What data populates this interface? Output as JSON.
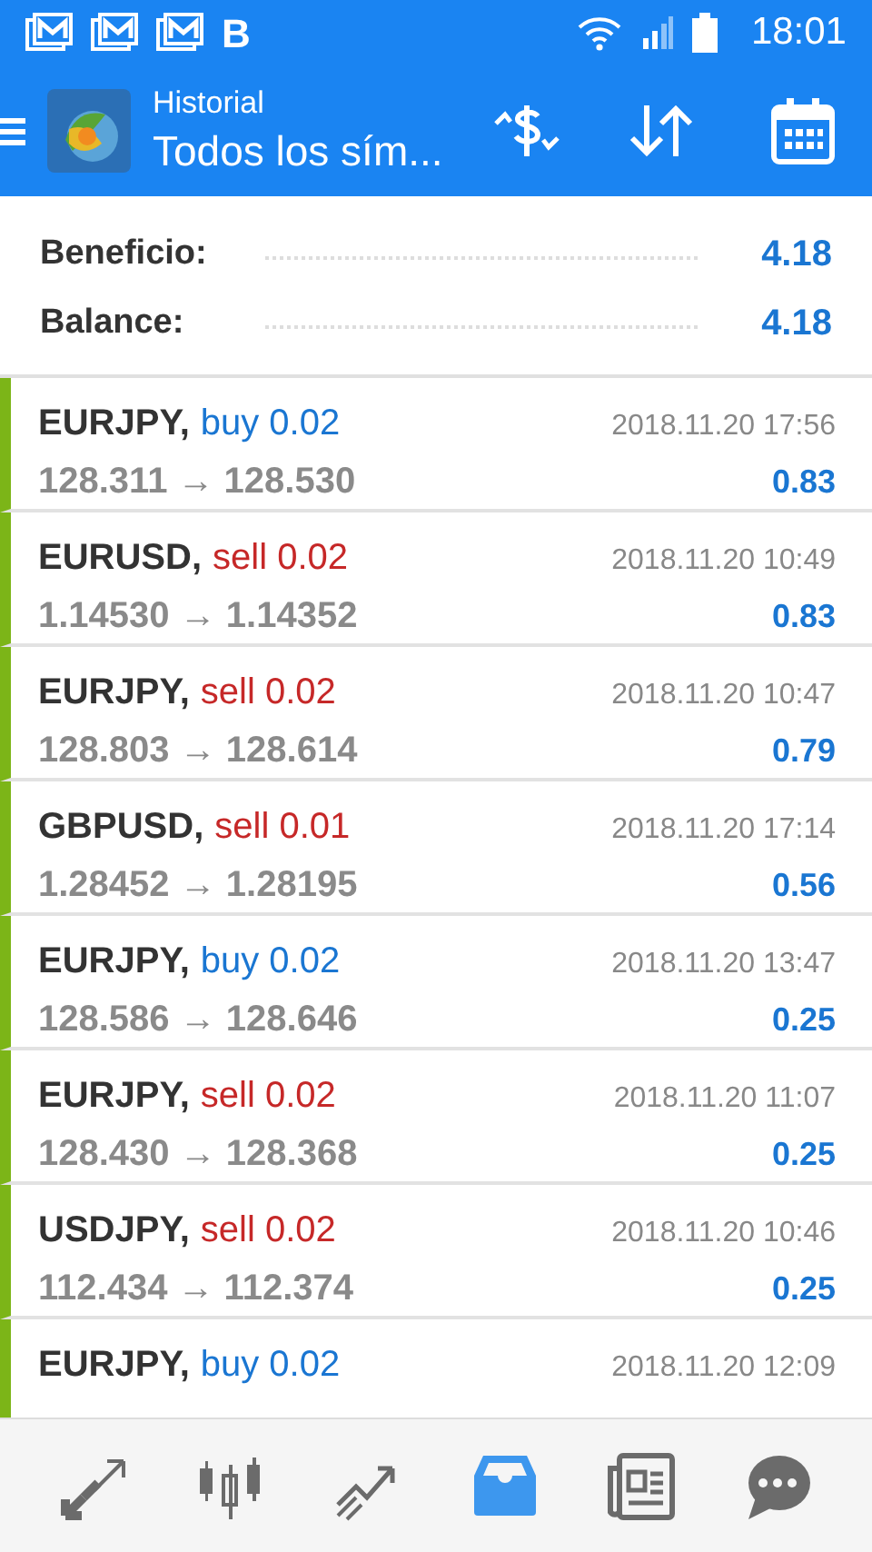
{
  "status_bar": {
    "time": "18:01",
    "notification_letter": "B"
  },
  "toolbar": {
    "subtitle": "Historial",
    "title": "Todos los sím..."
  },
  "summary": [
    {
      "label": "Beneficio:",
      "value": "4.18"
    },
    {
      "label": "Balance:",
      "value": "4.18"
    }
  ],
  "deals": [
    {
      "symbol": "EURJPY,",
      "side": "buy",
      "kind": "buy",
      "volume": "0.02",
      "time": "2018.11.20 17:56",
      "prices": "128.311 → 128.530",
      "profit": "0.83"
    },
    {
      "symbol": "EURUSD,",
      "side": "sell",
      "kind": "sell",
      "volume": "0.02",
      "time": "2018.11.20 10:49",
      "prices": "1.14530 → 1.14352",
      "profit": "0.83"
    },
    {
      "symbol": "EURJPY,",
      "side": "sell",
      "kind": "sell",
      "volume": "0.02",
      "time": "2018.11.20 10:47",
      "prices": "128.803 → 128.614",
      "profit": "0.79"
    },
    {
      "symbol": "GBPUSD,",
      "side": "sell",
      "kind": "sell",
      "volume": "0.01",
      "time": "2018.11.20 17:14",
      "prices": "1.28452 → 1.28195",
      "profit": "0.56"
    },
    {
      "symbol": "EURJPY,",
      "side": "buy",
      "kind": "buy",
      "volume": "0.02",
      "time": "2018.11.20 13:47",
      "prices": "128.586 → 128.646",
      "profit": "0.25"
    },
    {
      "symbol": "EURJPY,",
      "side": "sell",
      "kind": "sell",
      "volume": "0.02",
      "time": "2018.11.20 11:07",
      "prices": "128.430 → 128.368",
      "profit": "0.25"
    },
    {
      "symbol": "USDJPY,",
      "side": "sell",
      "kind": "sell",
      "volume": "0.02",
      "time": "2018.11.20 10:46",
      "prices": "112.434 → 112.374",
      "profit": "0.25"
    },
    {
      "symbol": "EURJPY,",
      "side": "buy",
      "kind": "buy",
      "volume": "0.02",
      "time": "2018.11.20 12:09"
    }
  ],
  "nav": [
    {
      "kind": "quotes",
      "selected": false
    },
    {
      "kind": "chart",
      "selected": false
    },
    {
      "kind": "trade",
      "selected": false
    },
    {
      "kind": "history",
      "selected": true
    },
    {
      "kind": "news",
      "selected": false
    },
    {
      "kind": "chat",
      "selected": false
    }
  ]
}
